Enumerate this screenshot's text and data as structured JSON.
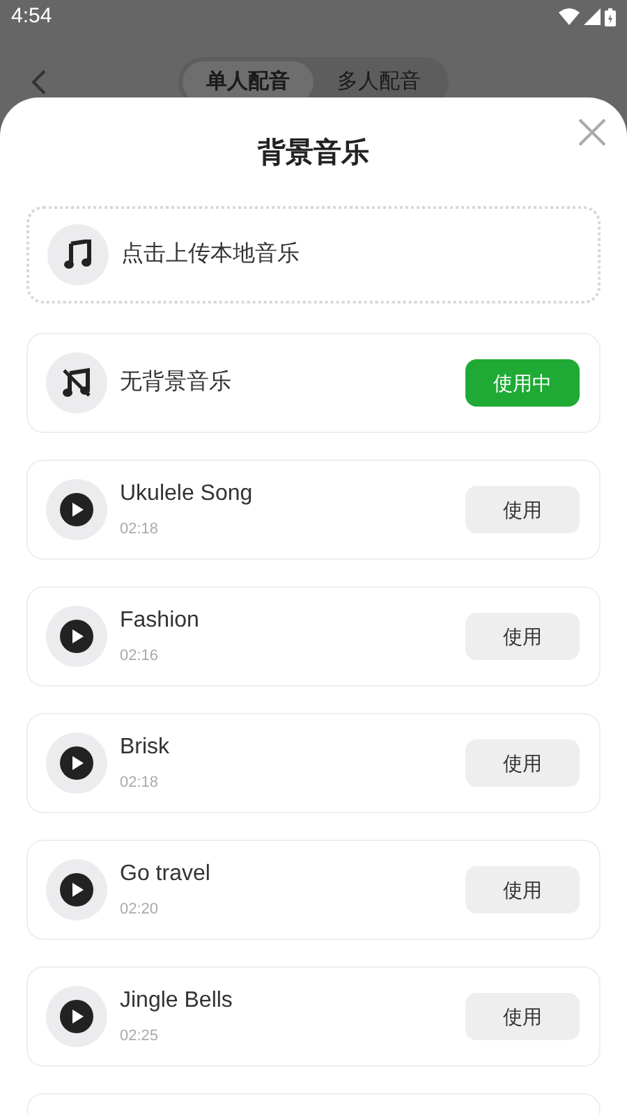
{
  "status_bar": {
    "time": "4:54"
  },
  "tabs": [
    {
      "label": "单人配音",
      "selected": true
    },
    {
      "label": "多人配音",
      "selected": false
    }
  ],
  "sheet": {
    "title": "背景音乐",
    "upload": {
      "label": "点击上传本地音乐"
    },
    "items": [
      {
        "kind": "none",
        "title": "无背景音乐",
        "button": "使用中",
        "selected": true
      },
      {
        "kind": "song",
        "title": "Ukulele Song",
        "duration": "02:18",
        "button": "使用",
        "selected": false
      },
      {
        "kind": "song",
        "title": "Fashion",
        "duration": "02:16",
        "button": "使用",
        "selected": false
      },
      {
        "kind": "song",
        "title": "Brisk",
        "duration": "02:18",
        "button": "使用",
        "selected": false
      },
      {
        "kind": "song",
        "title": "Go travel",
        "duration": "02:20",
        "button": "使用",
        "selected": false
      },
      {
        "kind": "song",
        "title": "Jingle Bells",
        "duration": "02:25",
        "button": "使用",
        "selected": false
      }
    ]
  }
}
